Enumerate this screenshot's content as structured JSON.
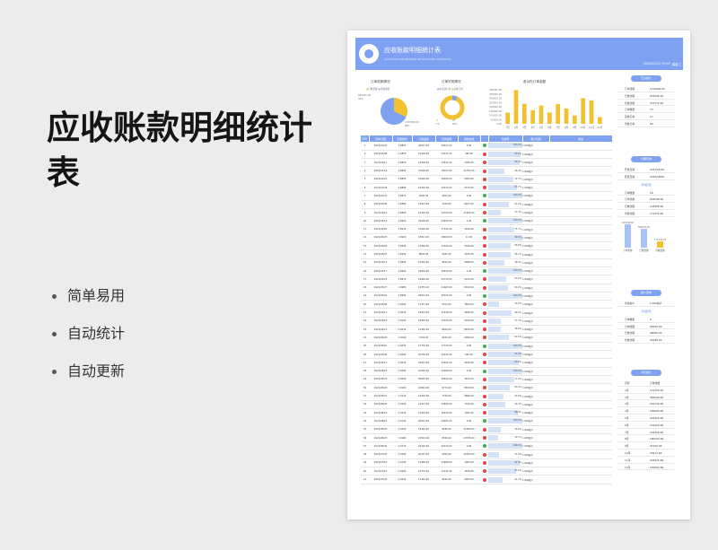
{
  "promo": {
    "title": "应收账款明细统计表",
    "features": [
      "简单易用",
      "自动统计",
      "自动更新"
    ]
  },
  "sheet": {
    "title": "应收账款明细统计表",
    "subtitle": "ACCOUNTS RECEIVABLE DETAILS AND STATISTICS",
    "date": "2022/02/22 09:07",
    "tag": "模板工"
  },
  "charts": {
    "pie": {
      "title": "订单收款情况",
      "legend": [
        "已收金额",
        "待收金额"
      ],
      "label_top": "805205.00",
      "label_top2": "32%",
      "label_bottom": "1707800.00",
      "label_bottom2": "68%",
      "values": [
        32,
        68
      ],
      "colors": [
        "#f2c12e",
        "#7ea2f1"
      ]
    },
    "donut": {
      "title": "订单完成情况",
      "legend": [
        "未完成订单",
        "完成订单"
      ],
      "label_left": "3",
      "label_left2": "7%",
      "label_right": "37",
      "label_right2": "93%",
      "values": [
        7,
        93
      ],
      "colors": [
        "#7ea2f1",
        "#f2c12e"
      ]
    },
    "bar": {
      "title": "各月份订单金额",
      "categories": [
        "1月",
        "2月",
        "3月",
        "4月",
        "5月",
        "6月",
        "7月",
        "8月",
        "9月",
        "10月",
        "11月",
        "12月"
      ],
      "values": [
        131150,
        395000,
        235130,
        160000,
        215300,
        132100,
        232350,
        180000,
        97150,
        300000,
        276000,
        80000
      ],
      "yticks": [
        "400000.00",
        "350000.00",
        "300000.00",
        "250000.00",
        "200000.00",
        "150000.00",
        "100000.00",
        "50000.00",
        "0.00"
      ],
      "ylim": [
        0,
        400000
      ],
      "color": "#f2c12e"
    }
  },
  "table": {
    "headers": [
      "序号",
      "签单日期",
      "应收账款",
      "订单金额",
      "已收金额",
      "待收金额",
      "",
      "完成率",
      "客户名称",
      "备注"
    ],
    "rows": [
      [
        "1",
        "2021/01/01",
        "1.8801",
        "20017.00",
        "20017.00",
        "0.00",
        "g",
        "100.0%",
        "1.000客户"
      ],
      [
        "2",
        "2021/01/08",
        "1.5850",
        "21436.00",
        "20071.00",
        "365.00",
        "r",
        "93.6%",
        "1.000客户"
      ],
      [
        "3",
        "2021/01/11",
        "1.8850",
        "14508.00",
        "13511.00",
        "1385.00",
        "r",
        "93.1%",
        "1.000客户"
      ],
      [
        "4",
        "2021/01/16",
        "1.8840",
        "21000.00",
        "18157.00",
        "11752.00",
        "r",
        "46.4%",
        "1.000客户"
      ],
      [
        "5",
        "2021/01/21",
        "1.8850",
        "22000.00",
        "16005.00",
        "5905.00",
        "r",
        "74.7%",
        "1.000客户"
      ],
      [
        "6",
        "2021/01/28",
        "1.8860",
        "10200.00",
        "10112.00",
        "4715.00",
        "r",
        "83.7%",
        "1.000客户"
      ],
      [
        "7",
        "2021/01/31",
        "1.8871",
        "4400.00",
        "4400.00",
        "0.00",
        "g",
        "100.0%",
        "1.000客户"
      ],
      [
        "8",
        "2021/02/06",
        "1.8880",
        "13013.00",
        "7106.00",
        "6917.00",
        "r",
        "61.0%",
        "1.000客户"
      ],
      [
        "9",
        "2021/02/10",
        "1.8890",
        "12100.00",
        "10700.00",
        "11914.00",
        "r",
        "37.4%",
        "1.000客户"
      ],
      [
        "10",
        "2021/02/15",
        "1.8900",
        "24200.00",
        "24200.00",
        "0.00",
        "g",
        "100.0%",
        "1.000客户"
      ],
      [
        "11",
        "2021/02/20",
        "1.8910",
        "22000.00",
        "17132.00",
        "4446.00",
        "r",
        "75.7%",
        "1.000客户"
      ],
      [
        "12",
        "2021/02/25",
        "1.8920",
        "18011.00",
        "18000.00",
        "11.00",
        "r",
        "99.9%",
        "1.000客户"
      ],
      [
        "13",
        "2021/03/02",
        "1.8930",
        "17000.00",
        "11022.00",
        "5326.00",
        "r",
        "66.8%",
        "1.000客户"
      ],
      [
        "14",
        "2021/03/07",
        "1.8940",
        "8600.00",
        "5641.00",
        "3161.00",
        "r",
        "66.1%",
        "1.000客户"
      ],
      [
        "15",
        "2021/03/12",
        "1.8950",
        "10250.00",
        "8292.00",
        "9968.00",
        "r",
        "46.3%",
        "1.000客户"
      ],
      [
        "16",
        "2021/03/17",
        "1.8960",
        "16530.00",
        "16530.00",
        "0.00",
        "g",
        "100.0%",
        "1.000客户"
      ],
      [
        "17",
        "2021/03/22",
        "1.8970",
        "19000.00",
        "10733.00",
        "9125.00",
        "r",
        "53.0%",
        "1.000客户"
      ],
      [
        "18",
        "2021/03/27",
        "1.8980",
        "12370.00",
        "11667.00",
        "8022.00",
        "r",
        "59.2%",
        "1.000客户"
      ],
      [
        "19",
        "2021/04/01",
        "1.8990",
        "25014.00",
        "25014.00",
        "0.00",
        "g",
        "100.0%",
        "1.000客户"
      ],
      [
        "20",
        "2021/04/06",
        "1.9000",
        "11371.00",
        "3702.00",
        "7669.00",
        "r",
        "32.6%",
        "1.000客户"
      ],
      [
        "21",
        "2021/04/11",
        "1.9010",
        "18412.00",
        "11218.00",
        "4996.00",
        "r",
        "69.2%",
        "1.000客户"
      ],
      [
        "22",
        "2021/04/16",
        "1.9020",
        "16550.00",
        "15330.00",
        "5200.00",
        "r",
        "37.3%",
        "1.000客户"
      ],
      [
        "23",
        "2021/04/21",
        "1.9030",
        "11450.00",
        "6620.00",
        "6830.00",
        "r",
        "38.0%",
        "1.000客户"
      ],
      [
        "24",
        "2021/04/26",
        "1.9040",
        "7202.00",
        "4441.00",
        "2996.00",
        "r",
        "61.6%",
        "1.000客户"
      ],
      [
        "25",
        "2021/05/01",
        "1.9050",
        "17770.00",
        "17770.00",
        "0.00",
        "g",
        "100.0%",
        "1.000客户"
      ],
      [
        "26",
        "2021/05/06",
        "1.9060",
        "20736.00",
        "20124.00",
        "650.00",
        "r",
        "97.0%",
        "1.000客户"
      ],
      [
        "27",
        "2021/05/11",
        "1.9070",
        "22041.00",
        "22021.00",
        "2246.00",
        "r",
        "90.0%",
        "1.000客户"
      ],
      [
        "28",
        "2021/05/16",
        "1.9080",
        "22000.00",
        "22000.00",
        "0.00",
        "g",
        "100.0%",
        "1.000客户"
      ],
      [
        "29",
        "2021/05/21",
        "1.9090",
        "20005.00",
        "16520.00",
        "4634.00",
        "r",
        "77.4%",
        "1.000客户"
      ],
      [
        "30",
        "2021/05/26",
        "1.9100",
        "10622.00",
        "9774.00",
        "5650.00",
        "r",
        "63.4%",
        "1.000客户"
      ],
      [
        "31",
        "2021/05/31",
        "1.9110",
        "12000.00",
        "7740.00",
        "9866.00",
        "r",
        "43.9%",
        "1.000客户"
      ],
      [
        "32",
        "2021/06/05",
        "1.9120",
        "21412.00",
        "13650.00",
        "7762.00",
        "r",
        "49.3%",
        "1.000客户"
      ],
      [
        "33",
        "2021/06/10",
        "1.9130",
        "11502.00",
        "10120.00",
        "1381.00",
        "r",
        "88.0%",
        "1.000客户"
      ],
      [
        "34",
        "2021/06/15",
        "1.9140",
        "20001.00",
        "20001.00",
        "0.00",
        "g",
        "100.0%",
        "1.000客户"
      ],
      [
        "35",
        "2021/06/20",
        "1.9150",
        "16140.00",
        "9436.00",
        "11360.00",
        "r",
        "36.0%",
        "1.000客户"
      ],
      [
        "36",
        "2021/06/25",
        "1.9160",
        "16510.00",
        "6526.00",
        "13745.00",
        "r",
        "29.7%",
        "1.000客户"
      ],
      [
        "37",
        "2021/06/30",
        "1.9170",
        "22120.00",
        "22120.00",
        "0.00",
        "g",
        "100.0%",
        "1.000客户"
      ],
      [
        "38",
        "2021/07/05",
        "1.9180",
        "20347.00",
        "9095.00",
        "20352.00",
        "r",
        "31.9%",
        "1.000客户"
      ],
      [
        "39",
        "2021/07/10",
        "1.9190",
        "13966.00",
        "13966.00",
        "1062.00",
        "r",
        "92.4%",
        "1.000客户"
      ],
      [
        "40",
        "2021/07/15",
        "1.9200",
        "12770.00",
        "11222.00",
        "1548.00",
        "r",
        "81.0%",
        "1.000客户"
      ],
      [
        "41",
        "2021/07/20",
        "1.9210",
        "11440.00",
        "9440.00",
        "2000.00",
        "r",
        "41.7%",
        "1.000客户"
      ]
    ]
  },
  "side": {
    "sec1": {
      "title": "汇总统计",
      "rows": [
        [
          "订单金额",
          "1215000.00"
        ],
        [
          "已收金额",
          "878206.00"
        ],
        [
          "待收金额",
          "337372.00"
        ],
        [
          "订单数量",
          "73"
        ],
        [
          "完成订单",
          "17"
        ],
        [
          "待收订单",
          "56"
        ]
      ]
    },
    "sec2": {
      "title": "日期查询",
      "rows": [
        [
          "开始日期",
          "2021/01/06"
        ],
        [
          "结束日期",
          "2022/08/06"
        ]
      ],
      "subtitle": "查询结果",
      "rows2": [
        [
          "订单数量",
          "16"
        ],
        [
          "订单金额",
          "633046.00"
        ],
        [
          "已收金额",
          "118356.00"
        ],
        [
          "待收金额",
          "171370.00"
        ]
      ],
      "bars": {
        "categories": [
          "订单金额",
          "已收金额",
          "待收金额"
        ],
        "values": [
          633046,
          508270,
          171370
        ],
        "labels": [
          "633046.00",
          "508270.00",
          "171370.00"
        ],
        "colors": [
          "#a7c2f4",
          "#a7c2f4",
          "#f2c12e"
        ]
      }
    },
    "sec3": {
      "title": "客户查询",
      "rows": [
        [
          "查询客户",
          "1.000客户"
        ]
      ],
      "subtitle": "查询结果",
      "rows2": [
        [
          "订单数量",
          "5"
        ],
        [
          "订单金额",
          "96500.00"
        ],
        [
          "已收金额",
          "48066.00"
        ],
        [
          "待收金额",
          "30246.00"
        ]
      ]
    },
    "sec4": {
      "title": "月份统计",
      "header": [
        "月份",
        "订单金额"
      ],
      "rows": [
        [
          "1月",
          "131150.00"
        ],
        [
          "2月",
          "365000.00"
        ],
        [
          "3月",
          "235130.00"
        ],
        [
          "4月",
          "160000.00"
        ],
        [
          "5月",
          "215300.00"
        ],
        [
          "6月",
          "132100.00"
        ],
        [
          "7月",
          "232350.00"
        ],
        [
          "8月",
          "180000.00"
        ],
        [
          "9月",
          "97150.00"
        ],
        [
          "10月",
          "79472.00"
        ],
        [
          "11月",
          "216915.00"
        ],
        [
          "12月",
          "150002.00"
        ]
      ]
    }
  }
}
